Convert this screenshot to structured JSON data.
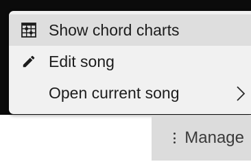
{
  "menu": {
    "items": [
      {
        "label": "Show chord charts",
        "icon": "chord-chart-icon",
        "highlighted": true
      },
      {
        "label": "Edit song",
        "icon": "pencil-icon",
        "highlighted": false
      },
      {
        "label": "Open current song",
        "icon": "",
        "has_submenu": true,
        "submenu_icon": "chevron-right-icon"
      }
    ]
  },
  "manage_button": {
    "label": "Manage",
    "icon": "kebab-menu-icon"
  },
  "colors": {
    "menu_background": "#f1f1f1",
    "menu_highlight": "#dedede",
    "button_background": "#dcdcdc",
    "app_background_dark": "#0b0b0b",
    "text": "#1c1c1c"
  }
}
